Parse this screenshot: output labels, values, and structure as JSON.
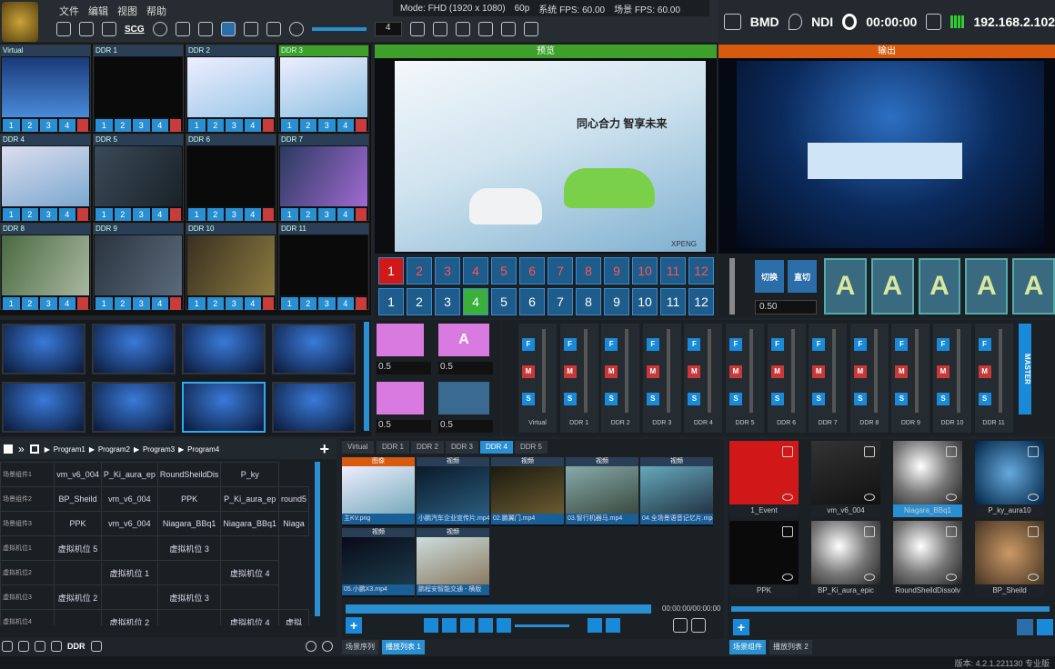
{
  "menu": {
    "items": [
      "文件",
      "编辑",
      "视图",
      "帮助"
    ]
  },
  "status": {
    "mode": "Mode: FHD (1920 x 1080)",
    "fps": "60p",
    "sys_fps": "系统 FPS: 60.00",
    "scene_fps": "场景 FPS: 60.00"
  },
  "toolbar": {
    "sc_label": "SCG",
    "spin_value": "4"
  },
  "topright": {
    "bmd": "BMD",
    "ndi": "NDI",
    "timer": "00:00:00",
    "ip": "192.168.2.102"
  },
  "grid_cells": [
    {
      "label": "Virtual"
    },
    {
      "label": "DDR 1"
    },
    {
      "label": "DDR 2"
    },
    {
      "label": "DDR 3"
    },
    {
      "label": "DDR 4"
    },
    {
      "label": "DDR 5"
    },
    {
      "label": "DDR 6"
    },
    {
      "label": "DDR 7"
    },
    {
      "label": "DDR 8"
    },
    {
      "label": "DDR 9"
    },
    {
      "label": "DDR 10"
    },
    {
      "label": "DDR 11"
    }
  ],
  "cell_nums": [
    "1",
    "2",
    "3",
    "4"
  ],
  "preview": {
    "title": "预览",
    "brand": "XPENG",
    "slogan": "同心合力 智享未来"
  },
  "output": {
    "title": "输出"
  },
  "pgm_row": [
    "1",
    "2",
    "3",
    "4",
    "5",
    "6",
    "7",
    "8",
    "9",
    "10",
    "11",
    "12"
  ],
  "pvw_row": [
    "1",
    "2",
    "3",
    "4",
    "5",
    "6",
    "7",
    "8",
    "9",
    "10",
    "11",
    "12"
  ],
  "switch": {
    "cut": "切换",
    "direct": "直切",
    "value": "0.50",
    "a": "A"
  },
  "trans": {
    "v1": "0.5",
    "v2": "0.5",
    "v3": "0.5",
    "v4": "0.5",
    "ab": "AB"
  },
  "mixer": {
    "channels": [
      "Virtual",
      "DDR 1",
      "DDR 2",
      "DDR 3",
      "DDR 4",
      "DDR 5",
      "DDR 6",
      "DDR 7",
      "DDR 8",
      "DDR 9",
      "DDR 10",
      "DDR 11"
    ],
    "master": "MASTER",
    "f": "F",
    "m": "M",
    "s": "S"
  },
  "programs": {
    "tabs": [
      "Program1",
      "Program2",
      "Program3",
      "Program4"
    ],
    "rows": [
      {
        "name": "场景组件1",
        "cells": [
          "vm_v6_004",
          "P_Ki_aura_ep",
          "RoundSheildDis",
          "P_ky"
        ]
      },
      {
        "name": "场景组件2",
        "cells": [
          "BP_Sheild",
          "vm_v6_004",
          "PPK",
          "P_Ki_aura_ep",
          "round5"
        ]
      },
      {
        "name": "场景组件3",
        "cells": [
          "PPK",
          "vm_v6_004",
          "Niagara_BBq1",
          "Niagara_BBq1",
          "Niaga"
        ]
      },
      {
        "name": "虚拟机位1",
        "cells": [
          "虚拟机位 5",
          "",
          "虚拟机位 3",
          ""
        ]
      },
      {
        "name": "虚拟机位2",
        "cells": [
          "",
          "虚拟机位 1",
          "",
          "虚拟机位 4"
        ]
      },
      {
        "name": "虚拟机位3",
        "cells": [
          "虚拟机位 2",
          "",
          "虚拟机位 3",
          ""
        ]
      },
      {
        "name": "虚拟机位4",
        "cells": [
          "",
          "虚拟机位 2",
          "",
          "虚拟机位 4",
          "虚拟"
        ]
      }
    ]
  },
  "media_tabs": [
    "Virtual",
    "DDR 1",
    "DDR 2",
    "DDR 3",
    "DDR 4",
    "DDR 5"
  ],
  "media": [
    {
      "head": "图像",
      "file": "主KV.png"
    },
    {
      "head": "视频",
      "file": "小鹏汽车企业宣传片.mp4"
    },
    {
      "head": "视频",
      "file": "02.鹏翼门.mp4"
    },
    {
      "head": "视频",
      "file": "03.智行机器马.mp4"
    },
    {
      "head": "视频",
      "file": "04.全场景语音记忆片.mp4"
    },
    {
      "head": "视频",
      "file": "05.小鹏X3.mp4"
    },
    {
      "head": "视频",
      "file": "鹏程安智能交通 - 横版"
    }
  ],
  "media_time": "00:00:00/00:00:00",
  "assets": [
    {
      "label": "1_Event"
    },
    {
      "label": "vm_v6_004"
    },
    {
      "label": "Niagara_BBq1"
    },
    {
      "label": "P_ky_aura10"
    },
    {
      "label": "PPK"
    },
    {
      "label": "BP_Ki_aura_epic"
    },
    {
      "label": "RoundSheildDissolv"
    },
    {
      "label": "BP_Sheild"
    }
  ],
  "bottom_tabs": {
    "left": [
      "场景序列",
      "播放列表 1"
    ],
    "right": [
      "场景组件",
      "播放列表 2"
    ]
  },
  "statusbar": {
    "ddr": "DDR",
    "version": "版本: 4.2.1.221130 专业版"
  }
}
